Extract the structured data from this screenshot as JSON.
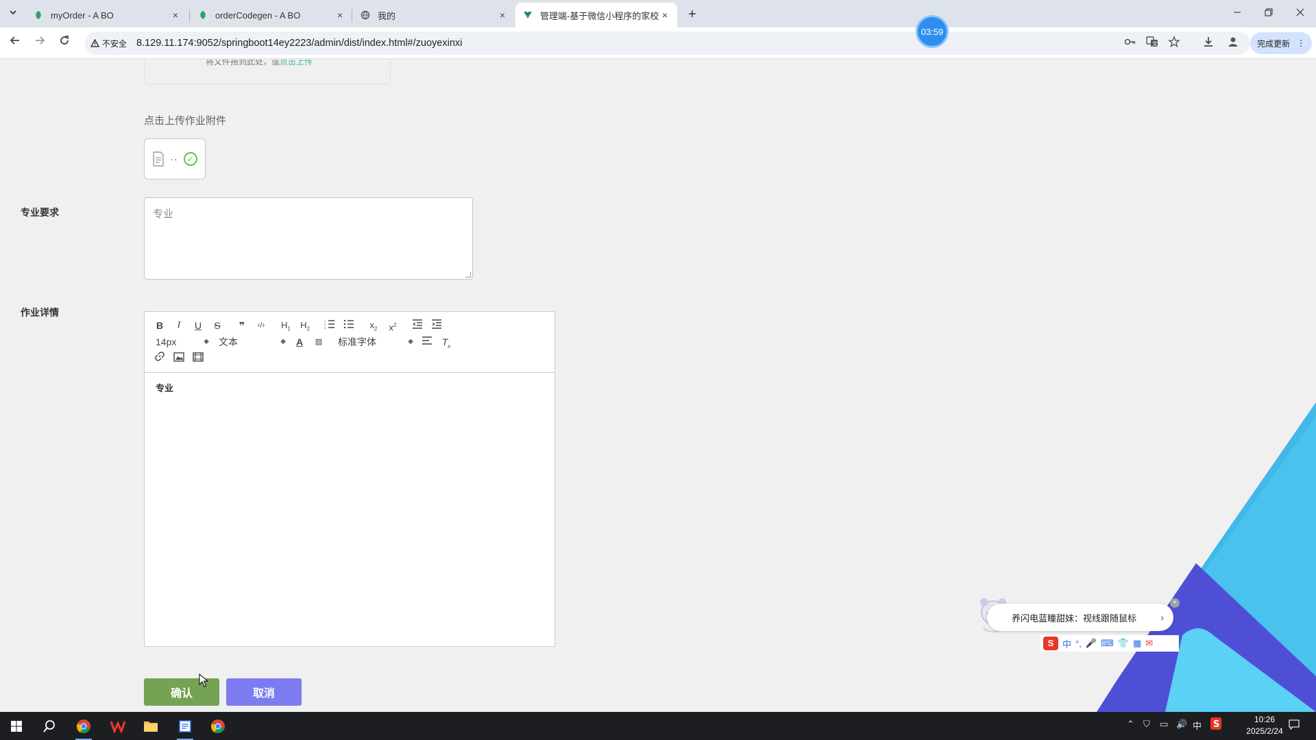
{
  "browser": {
    "tabs": [
      {
        "title": "myOrder - A BO",
        "close": "×",
        "favicon": "green-leaf-icon"
      },
      {
        "title": "orderCodegen - A BO",
        "close": "×",
        "favicon": "green-leaf-icon"
      },
      {
        "title": "我的",
        "close": "×",
        "favicon": "globe-icon"
      },
      {
        "title": "管理端-基于微信小程序的家校",
        "close": "×",
        "favicon": "vue-icon"
      }
    ],
    "new_tab": "+",
    "security_label": "不安全",
    "url": "8.129.11.174:9052/springboot14ey2223/admin/dist/index.html#/zuoyexinxi",
    "update_button": "完成更新",
    "timer": "03:59"
  },
  "form": {
    "upload_hint_prefix": "将文件拖到此处，或",
    "upload_hint_link": "点击上传",
    "attachment_label": "点击上传作业附件",
    "attachment_dots": "··",
    "requirement_label": "专业要求",
    "requirement_value": "专业",
    "detail_label": "作业详情",
    "editor": {
      "font_size": "14px",
      "header_select": "文本",
      "font_family": "标准字体",
      "content": "专业"
    },
    "confirm_button": "确认",
    "cancel_button": "取消"
  },
  "overlay": {
    "notification": "养闪电蓝瞳甜妹：视线跟随鼠标",
    "ime_chinese": "中"
  },
  "taskbar": {
    "tray_ime": "中",
    "time": "10:26",
    "date": "2025/2/24"
  },
  "colors": {
    "confirm": "#74a354",
    "cancel": "#7c7cf0",
    "deco_blue": "#4f4fd6",
    "deco_cyan": "#5ad1f5",
    "deco_light": "#41b8e8"
  }
}
